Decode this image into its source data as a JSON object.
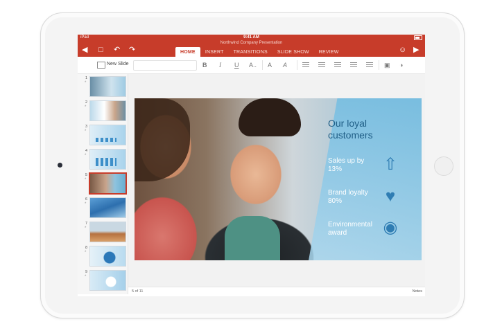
{
  "status": {
    "carrier": "iPad",
    "time": "9:41 AM"
  },
  "document": {
    "title": "Northwind Company Presentation"
  },
  "ribbon": {
    "tabs": [
      {
        "label": "HOME",
        "active": true
      },
      {
        "label": "INSERT",
        "active": false
      },
      {
        "label": "TRANSITIONS",
        "active": false
      },
      {
        "label": "SLIDE SHOW",
        "active": false
      },
      {
        "label": "REVIEW",
        "active": false
      }
    ]
  },
  "toolbar": {
    "new_slide_label": "New Slide",
    "bold": "B",
    "italic": "I",
    "underline": "U",
    "font_effects": "A..",
    "font_color": "A",
    "highlight": "A"
  },
  "thumbnails": [
    {
      "num": "1",
      "star": "*"
    },
    {
      "num": "2",
      "star": "*"
    },
    {
      "num": "3",
      "star": "*"
    },
    {
      "num": "4",
      "star": "*"
    },
    {
      "num": "5",
      "star": "*",
      "selected": true
    },
    {
      "num": "6",
      "star": "*"
    },
    {
      "num": "7",
      "star": "*"
    },
    {
      "num": "8",
      "star": "*"
    },
    {
      "num": "9",
      "star": "*"
    }
  ],
  "slide": {
    "title": "Our loyal customers",
    "items": [
      {
        "text": "Sales up by 13%",
        "icon": "dollar-arrow-icon"
      },
      {
        "text": "Brand loyalty 80%",
        "icon": "heart-icon"
      },
      {
        "text": "Environmental award",
        "icon": "globe-award-icon"
      }
    ]
  },
  "footer": {
    "page_count": "5 of 11",
    "notes_label": "Notes"
  },
  "colors": {
    "accent": "#c73c2a",
    "slide_blue": "#2f7db3"
  }
}
